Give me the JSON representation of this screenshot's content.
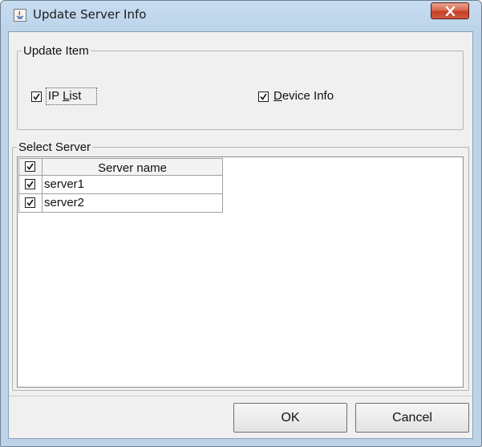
{
  "window": {
    "title": "Update Server Info",
    "icon": "java-app-icon",
    "close_icon": "close-icon"
  },
  "update_item": {
    "title": "Update Item",
    "ip_list": {
      "label_mnemonic": "IP ",
      "label_underlined": "L",
      "label_rest": "ist",
      "checked": true
    },
    "device_info": {
      "label_underlined": "D",
      "label_rest": "evice Info",
      "checked": true
    }
  },
  "select_server": {
    "title": "Select Server",
    "columns": [
      "",
      "Server name"
    ],
    "header_checked": true,
    "rows": [
      {
        "checked": true,
        "name": "server1"
      },
      {
        "checked": true,
        "name": "server2"
      }
    ]
  },
  "buttons": {
    "ok": "OK",
    "cancel": "Cancel"
  },
  "colors": {
    "title_bar": "#bcd3ea",
    "close_button": "#c4402a",
    "dialog_background": "#f0f0f0"
  }
}
